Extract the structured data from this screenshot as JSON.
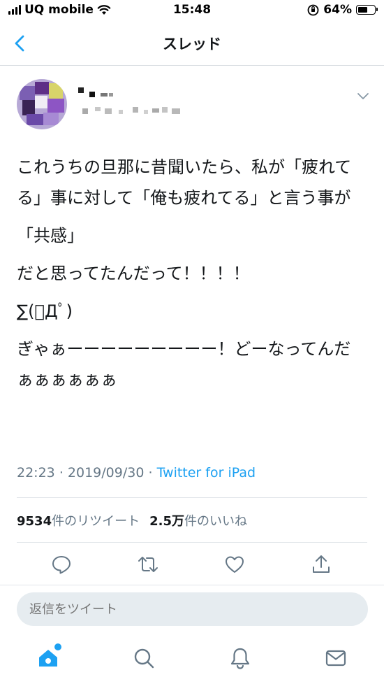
{
  "status_bar": {
    "carrier": "UQ mobile",
    "time": "15:48",
    "battery_percent": "64%",
    "battery_level": 0.64
  },
  "header": {
    "title": "スレッド",
    "back_icon": "chevron-left-icon"
  },
  "tweet": {
    "text_lines": [
      "これうちの旦那に昔聞いたら、私が「疲れてる」事に対して「俺も疲れてる」と言う事が",
      "「共感」",
      "だと思ってたんだって！！！！",
      "∑(ﾟДﾟ)",
      "ぎゃぁーーーーーーーーー！どーなってんだぁぁぁぁぁぁ"
    ],
    "time": "22:23",
    "date": "2019/09/30",
    "separator": "·",
    "via": "Twitter for iPad"
  },
  "stats": {
    "retweets_count": "9534",
    "retweets_label": "件のリツイート",
    "likes_count": "2.5万",
    "likes_label": "件のいいね"
  },
  "actions": [
    "reply-icon",
    "retweet-icon",
    "like-icon",
    "share-icon"
  ],
  "reply": {
    "placeholder": "返信をツイート"
  },
  "tabs": [
    "home-icon",
    "search-icon",
    "notifications-icon",
    "messages-icon"
  ],
  "colors": {
    "accent": "#1da1f2",
    "secondary_text": "#657786",
    "divider": "#e1e5e9",
    "input_bg": "#e6ecf0"
  }
}
